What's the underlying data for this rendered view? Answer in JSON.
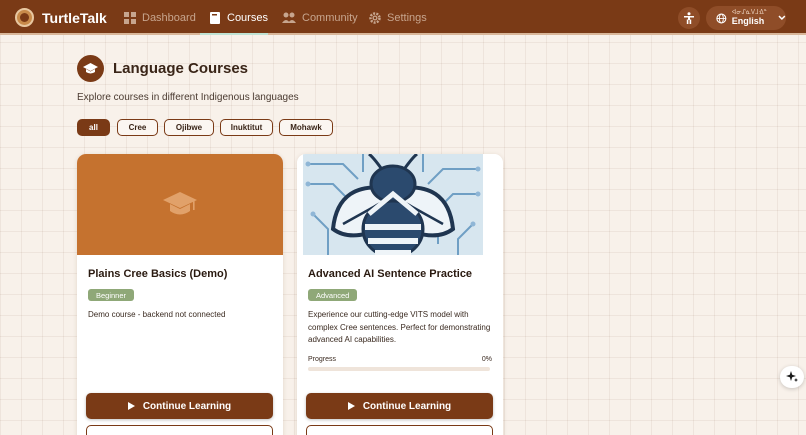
{
  "app": {
    "name": "TurtleTalk"
  },
  "nav": {
    "dashboard": "Dashboard",
    "courses": "Courses",
    "community": "Community",
    "settings": "Settings"
  },
  "language": {
    "native": "ᐊᓂᔑᓈᐯᒧᐎᓐ",
    "label": "English"
  },
  "page": {
    "title": "Language Courses",
    "subtitle": "Explore courses in different Indigenous languages"
  },
  "filters": [
    "all",
    "Cree",
    "Ojibwe",
    "Inuktitut",
    "Mohawk"
  ],
  "cards": [
    {
      "title": "Plains Cree Basics (Demo)",
      "level": "Beginner",
      "description": "Demo course - backend not connected",
      "cta": "Continue Learning"
    },
    {
      "title": "Advanced AI Sentence Practice",
      "level": "Advanced",
      "description": "Experience our cutting-edge VITS model with complex Cree sentences. Perfect for demonstrating advanced AI capabilities.",
      "progress_label": "Progress",
      "progress_text": "0%",
      "progress": 0,
      "cta": "Continue Learning"
    }
  ],
  "colors": {
    "primary": "#7a3a16",
    "card1_media": "#c5722f",
    "badge": "#8fa878",
    "background": "#f8f1ea"
  },
  "icons": {
    "logo": "turtle-logo-icon",
    "dashboard": "grid-icon",
    "courses": "book-icon",
    "community": "people-icon",
    "settings": "gear-icon",
    "accessibility": "accessibility-icon",
    "language": "globe-icon",
    "dropdown": "chevron-down-icon",
    "title": "graduation-cap-icon",
    "play": "play-icon",
    "assistant": "sparkle-icon"
  }
}
